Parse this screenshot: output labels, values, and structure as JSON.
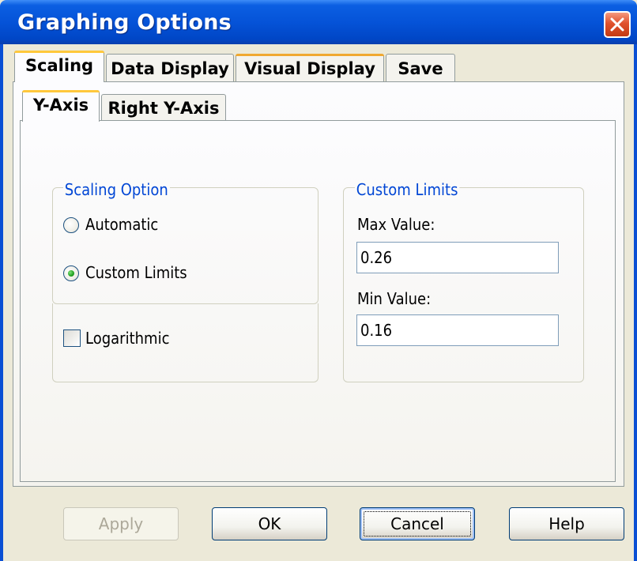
{
  "window": {
    "title": "Graphing Options"
  },
  "tabs": [
    {
      "label": "Scaling"
    },
    {
      "label": "Data Display"
    },
    {
      "label": "Visual Display"
    },
    {
      "label": "Save"
    }
  ],
  "subtabs": [
    {
      "label": "Y-Axis"
    },
    {
      "label": "Right Y-Axis"
    }
  ],
  "scaling_option": {
    "legend": "Scaling Option",
    "automatic_label": "Automatic",
    "custom_label": "Custom Limits",
    "selected": "Custom Limits",
    "logarithmic_label": "Logarithmic",
    "logarithmic_checked": false
  },
  "custom_limits": {
    "legend": "Custom Limits",
    "max_label": "Max Value:",
    "max_value": "0.26",
    "min_label": "Min Value:",
    "min_value": "0.16"
  },
  "buttons": {
    "apply": "Apply",
    "ok": "OK",
    "cancel": "Cancel",
    "help": "Help"
  },
  "colors": {
    "titlebar": "#0553d8",
    "group_legend": "#0046d5",
    "active_tab_accent": "#ffc83c",
    "radio_selected": "#21a121"
  }
}
